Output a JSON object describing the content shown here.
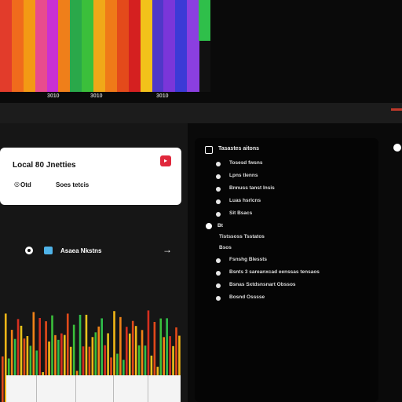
{
  "top_visualizer": {
    "labels": [
      "3010",
      "3010",
      "3010"
    ],
    "columns": [
      {
        "color": "#e23c2b"
      },
      {
        "color": "#f06b1c"
      },
      {
        "color": "#f39a14"
      },
      {
        "color": "#e84c8e"
      },
      {
        "color": "#c930d4"
      },
      {
        "color": "#ef7f1a"
      },
      {
        "color": "#2aa84a"
      },
      {
        "color": "#3bbf3b"
      },
      {
        "color": "#f0a818"
      },
      {
        "color": "#ef7a18"
      },
      {
        "color": "#e34a1b"
      },
      {
        "color": "#d52020"
      },
      {
        "color": "#f2c21a"
      },
      {
        "color": "#4f38c8"
      },
      {
        "color": "#7a36d9"
      },
      {
        "color": "#3c3ad6"
      },
      {
        "color": "#8b3fe0"
      },
      {
        "color": "#2fbf4a"
      }
    ]
  },
  "local_card": {
    "title": "Local 80 Jnetties",
    "badge_icon": "play-icon",
    "status_icon": "link-icon",
    "status": "Otd",
    "sub": "Soes tetcis"
  },
  "assets": {
    "label": "Asaea Nkstns",
    "arrow": "→"
  },
  "right_panel": {
    "title": "Tasastes aitons",
    "items_top": [
      "Tosesd fwsns",
      "Lpns tlenns",
      "Bnnuss tanst Insis",
      "Luas hsrlcns",
      "Sit Bsacs"
    ],
    "section_label": "Bt",
    "plain_items": [
      "Tistssoss Tsstatos",
      "Bsos"
    ],
    "items_bottom": [
      "Fsnshg Blessts",
      "Bsnts 3 sareanxcad eenssas tensaos",
      "Bsnas Sxtdsnsnart Obssos",
      "Bosnd Osssse"
    ]
  },
  "bottom_visualizer": {
    "bar_colors": [
      "#e24a1a",
      "#f0b617",
      "#3bbf3b",
      "#f08318",
      "#2fbf4a",
      "#d62f1f",
      "#e8c21c"
    ]
  }
}
